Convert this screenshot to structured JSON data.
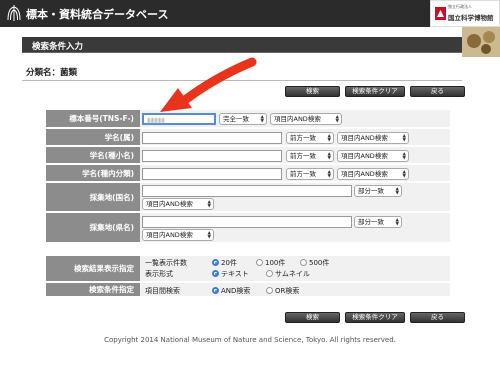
{
  "header": {
    "site_title": "標本・資料統合データベース",
    "org_sub": "独立行政法人",
    "org_name": "国立科学博物館"
  },
  "banner": {
    "title": "検索条件入力"
  },
  "category": {
    "label": "分類名：菌類"
  },
  "buttons": {
    "search": "検索",
    "clear": "検索条件クリア",
    "back": "戻る"
  },
  "fields": [
    {
      "label": "標本番号(TNS-F-)",
      "value": "▮▮▮▮▮",
      "select1": "完全一致",
      "select2": "項目内AND検索"
    },
    {
      "label": "学名(属)",
      "value": "",
      "select1": "前方一致",
      "select2": "項目内AND検索"
    },
    {
      "label": "学名(種小名)",
      "value": "",
      "select1": "前方一致",
      "select2": "項目内AND検索"
    },
    {
      "label": "学名(種内分類)",
      "value": "",
      "select1": "前方一致",
      "select2": "項目内AND検索"
    },
    {
      "label": "採集地(国名)",
      "value": "",
      "select1": "部分一致",
      "select2": "項目内AND検索"
    },
    {
      "label": "採集地(県名)",
      "value": "",
      "select1": "部分一致",
      "select2": "項目内AND検索"
    }
  ],
  "display": {
    "label": "検索結果表示指定",
    "count_label": "一覧表示件数",
    "count_options": [
      "20件",
      "100件",
      "500件"
    ],
    "count_selected": "20件",
    "format_label": "表示形式",
    "format_options": [
      "テキスト",
      "サムネイル"
    ],
    "format_selected": "テキスト"
  },
  "condition": {
    "label": "検索条件指定",
    "item_label": "項目間検索",
    "options": [
      "AND検索",
      "OR検索"
    ],
    "selected": "AND検索"
  },
  "footer": {
    "copyright": "Copyright 2014 National Museum of Nature and Science, Tokyo. All rights reserved."
  },
  "colors": {
    "topbar": "#2b2b2b",
    "label_bg": "#8c8c8c",
    "arrow": "#e8341c",
    "focus": "#5a8ad6"
  }
}
